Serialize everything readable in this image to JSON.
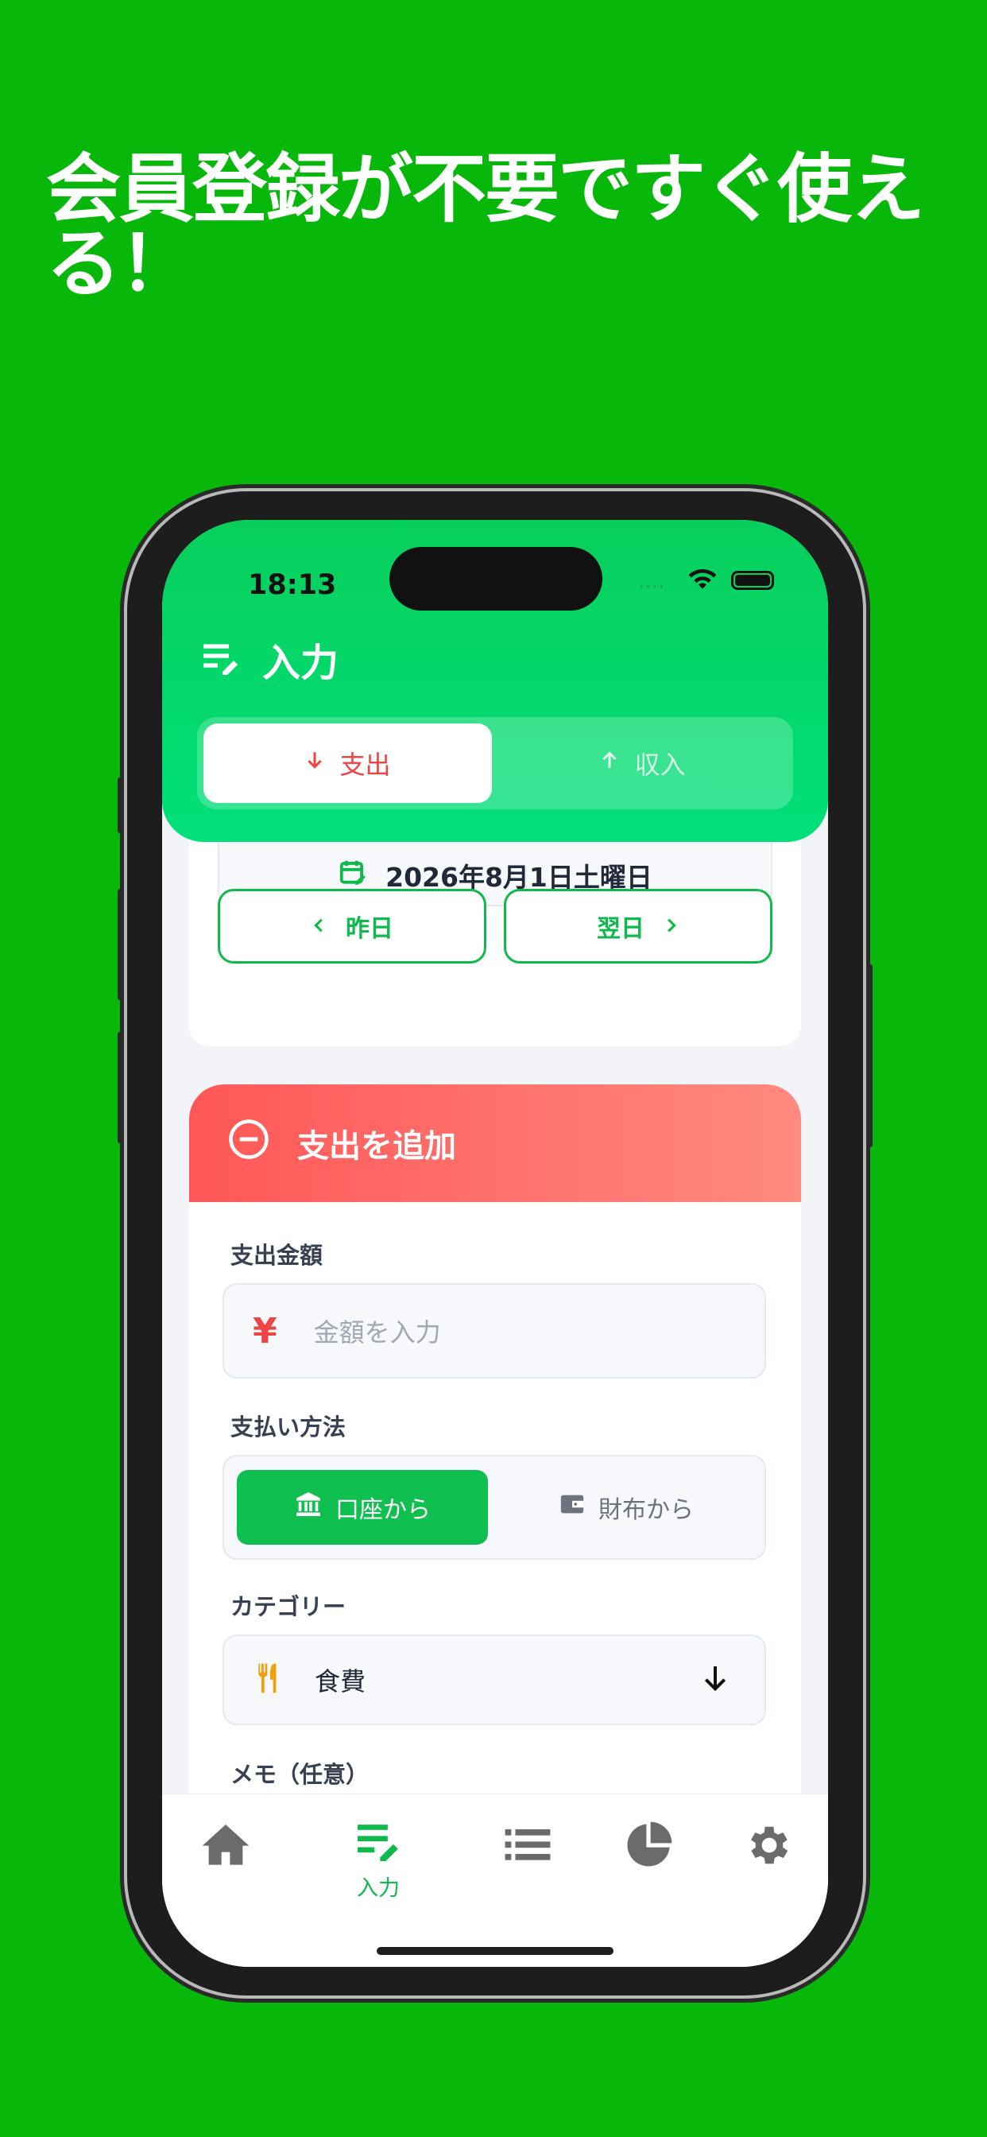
{
  "headline": "会員登録が不要ですぐ使える！",
  "status": {
    "time": "18:13"
  },
  "header": {
    "title": "入力"
  },
  "type_toggle": {
    "expense": "支出",
    "income": "収入"
  },
  "date": {
    "current": "2026年8月1日土曜日",
    "prev_label": "昨日",
    "next_label": "翌日"
  },
  "add_card": {
    "title": "支出を追加",
    "amount_label": "支出金額",
    "amount_placeholder": "金額を入力",
    "currency": "¥",
    "payment_label": "支払い方法",
    "payment_options": [
      "口座から",
      "財布から"
    ],
    "category_label": "カテゴリー",
    "category_value": "食費",
    "memo_label": "メモ（任意）"
  },
  "tabbar": {
    "input_label": "入力"
  },
  "colors": {
    "background": "#07b80b",
    "accent": "#10b94c",
    "expense": "#ef4444"
  }
}
